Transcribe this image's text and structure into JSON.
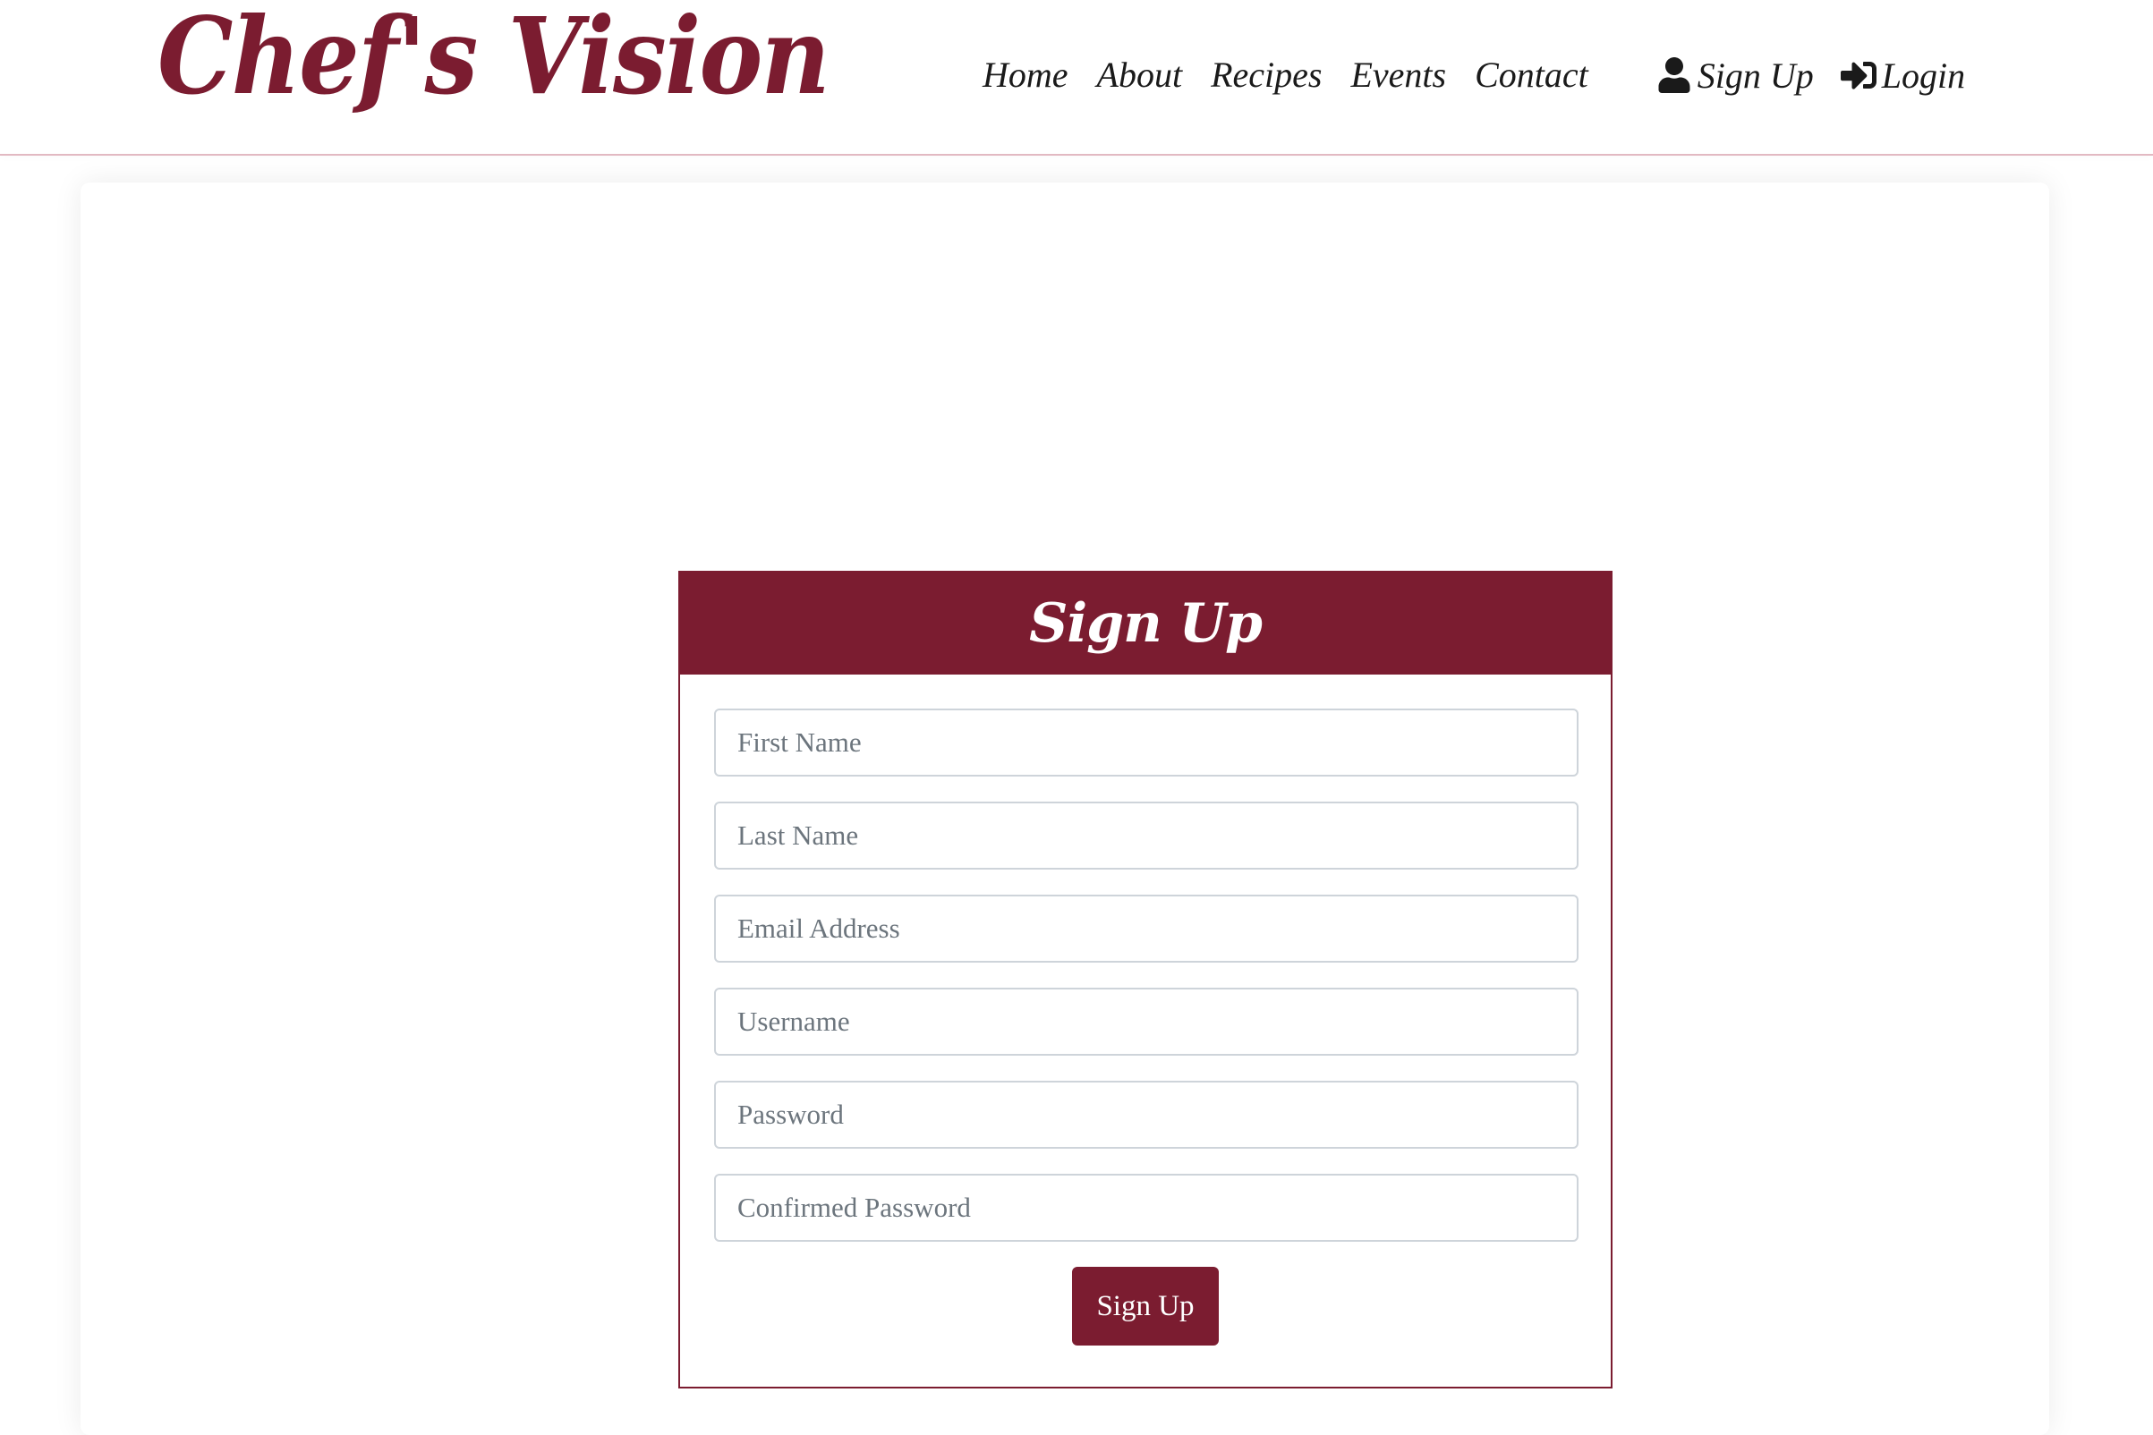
{
  "header": {
    "brand": "Chef's Vision",
    "nav": [
      {
        "label": "Home"
      },
      {
        "label": "About"
      },
      {
        "label": "Recipes"
      },
      {
        "label": "Events"
      },
      {
        "label": "Contact"
      }
    ],
    "auth": [
      {
        "label": "Sign Up",
        "icon": "user-icon"
      },
      {
        "label": "Login",
        "icon": "sign-in-icon"
      }
    ]
  },
  "signup_form": {
    "title": "Sign Up",
    "fields": [
      {
        "placeholder": "First Name",
        "value": ""
      },
      {
        "placeholder": "Last Name",
        "value": ""
      },
      {
        "placeholder": "Email Address",
        "value": ""
      },
      {
        "placeholder": "Username",
        "value": ""
      },
      {
        "placeholder": "Password",
        "value": ""
      },
      {
        "placeholder": "Confirmed Password",
        "value": ""
      }
    ],
    "submit_label": "Sign Up"
  },
  "colors": {
    "brand": "#7b1c30",
    "nav_text": "#1a1a1a",
    "input_border": "#ced4da",
    "placeholder": "#6c757d"
  }
}
